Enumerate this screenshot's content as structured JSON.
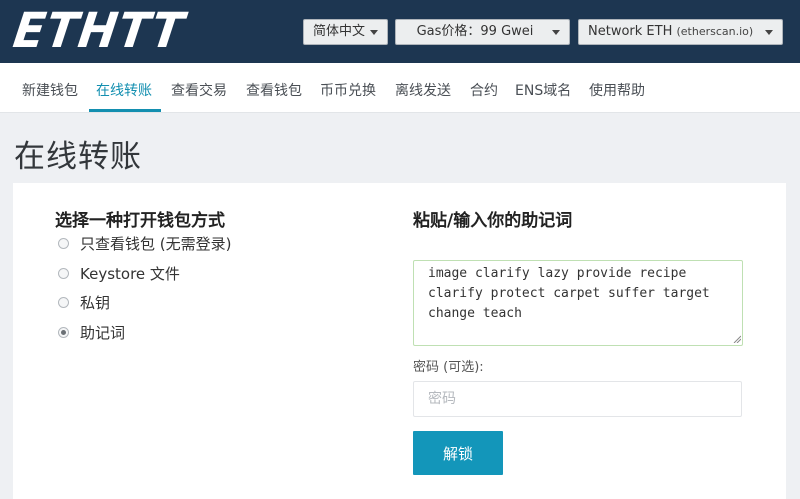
{
  "header": {
    "logo_text": "ETHTT",
    "language_select": "简体中文",
    "gas_select": "Gas价格：99 Gwei",
    "network_select_main": "Network ETH",
    "network_select_sub": "(etherscan.io)"
  },
  "nav": {
    "items": [
      {
        "label": "新建钱包"
      },
      {
        "label": "在线转账",
        "active": true
      },
      {
        "label": "查看交易"
      },
      {
        "label": "查看钱包"
      },
      {
        "label": "币币兑换"
      },
      {
        "label": "离线发送"
      },
      {
        "label": "合约"
      },
      {
        "label": "ENS域名"
      },
      {
        "label": "使用帮助"
      }
    ],
    "accent_color": "#138fb0"
  },
  "page": {
    "title": "在线转账"
  },
  "wallet_access": {
    "heading": "选择一种打开钱包方式",
    "options": [
      {
        "label": "只查看钱包 (无需登录)",
        "checked": false
      },
      {
        "label": "Keystore 文件",
        "checked": false
      },
      {
        "label": "私钥",
        "checked": false
      },
      {
        "label": "助记词",
        "checked": true
      }
    ]
  },
  "mnemonic_form": {
    "heading": "粘贴/输入你的助记词",
    "mnemonic_value": "image clarify lazy provide recipe clarify protect carpet suffer target change teach",
    "password_label": "密码 (可选):",
    "password_placeholder": "密码",
    "unlock_label": "解锁"
  },
  "colors": {
    "header_bg": "#1d3651",
    "button_bg": "#1396ba",
    "page_bg": "#eef0f3"
  }
}
